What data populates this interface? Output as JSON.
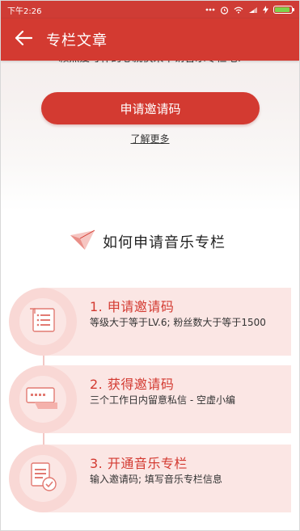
{
  "status_bar": {
    "time": "下午2:26",
    "icons": [
      "more-dots-icon",
      "alarm-icon",
      "wifi-icon",
      "signal-icon",
      "charging-icon",
      "battery-icon"
    ],
    "battery_level": 0.9
  },
  "app_bar": {
    "title": "专栏文章",
    "back_icon": "arrow-left-icon"
  },
  "top": {
    "partial_text": "赖然爱写作的心就快来申请音乐专栏吧!",
    "apply_button": "申请邀请码",
    "learn_more": "了解更多"
  },
  "how_to": {
    "title": "如何申请音乐专栏"
  },
  "steps": [
    {
      "title": "1. 申请邀请码",
      "desc": "等级大于等于LV.6; 粉丝数大于等于1500",
      "icon": "scroll-list-icon"
    },
    {
      "title": "2. 获得邀请码",
      "desc": "三个工作日内留意私信 - 空虚小编",
      "icon": "ticket-hand-icon"
    },
    {
      "title": "3. 开通音乐专栏",
      "desc": "输入邀请码; 填写音乐专栏信息",
      "icon": "document-check-icon"
    }
  ],
  "colors": {
    "primary": "#d33a31",
    "card": "#fbe6e4",
    "circle": "#f9d8d5"
  }
}
